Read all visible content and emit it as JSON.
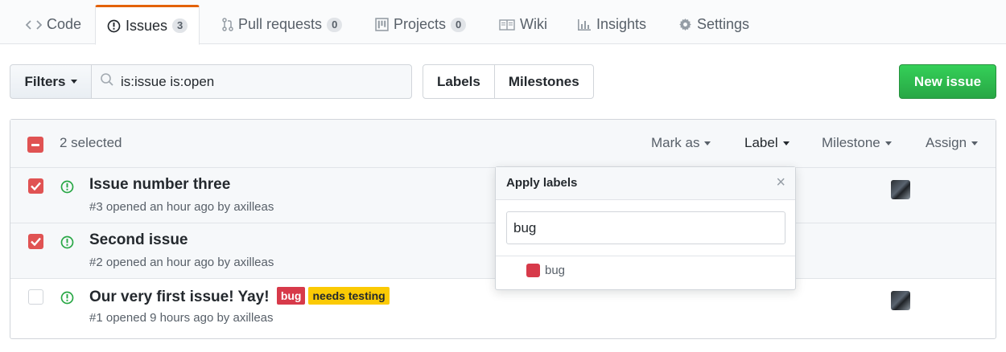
{
  "tabs": [
    {
      "label": "Code",
      "icon": "code-icon"
    },
    {
      "label": "Issues",
      "icon": "issue-opened-icon",
      "count": "3"
    },
    {
      "label": "Pull requests",
      "icon": "git-pull-request-icon",
      "count": "0"
    },
    {
      "label": "Projects",
      "icon": "project-icon",
      "count": "0"
    },
    {
      "label": "Wiki",
      "icon": "book-icon"
    },
    {
      "label": "Insights",
      "icon": "graph-icon"
    },
    {
      "label": "Settings",
      "icon": "gear-icon"
    }
  ],
  "filters": {
    "button_label": "Filters",
    "search_value": "is:issue is:open"
  },
  "subnav": {
    "labels": "Labels",
    "milestones": "Milestones"
  },
  "new_issue_label": "New issue",
  "bulk": {
    "selected_text": "2 selected",
    "mark_as": "Mark as",
    "label": "Label",
    "milestone": "Milestone",
    "assign": "Assign"
  },
  "issues": [
    {
      "title": "Issue number three",
      "meta": "#3 opened an hour ago by axilleas",
      "checked": true,
      "avatar": true
    },
    {
      "title": "Second issue",
      "meta": "#2 opened an hour ago by axilleas",
      "checked": true,
      "avatar": false
    },
    {
      "title": "Our very first issue! Yay!",
      "meta": "#1 opened 9 hours ago by axilleas",
      "checked": false,
      "avatar": true,
      "labels": [
        {
          "name": "bug",
          "color": "#d73a4a",
          "text_color": "#ffffff"
        },
        {
          "name": "needs testing",
          "color": "#fbca04",
          "text_color": "#24292e"
        }
      ]
    }
  ],
  "label_dropdown": {
    "title": "Apply labels",
    "filter_value": "bug",
    "items": [
      {
        "name": "bug",
        "color": "#d73a4a"
      }
    ]
  },
  "colors": {
    "accent": "#e36209",
    "checkbox": "#e05353",
    "open_issue": "#28a745",
    "primary_button": "#28a745"
  }
}
